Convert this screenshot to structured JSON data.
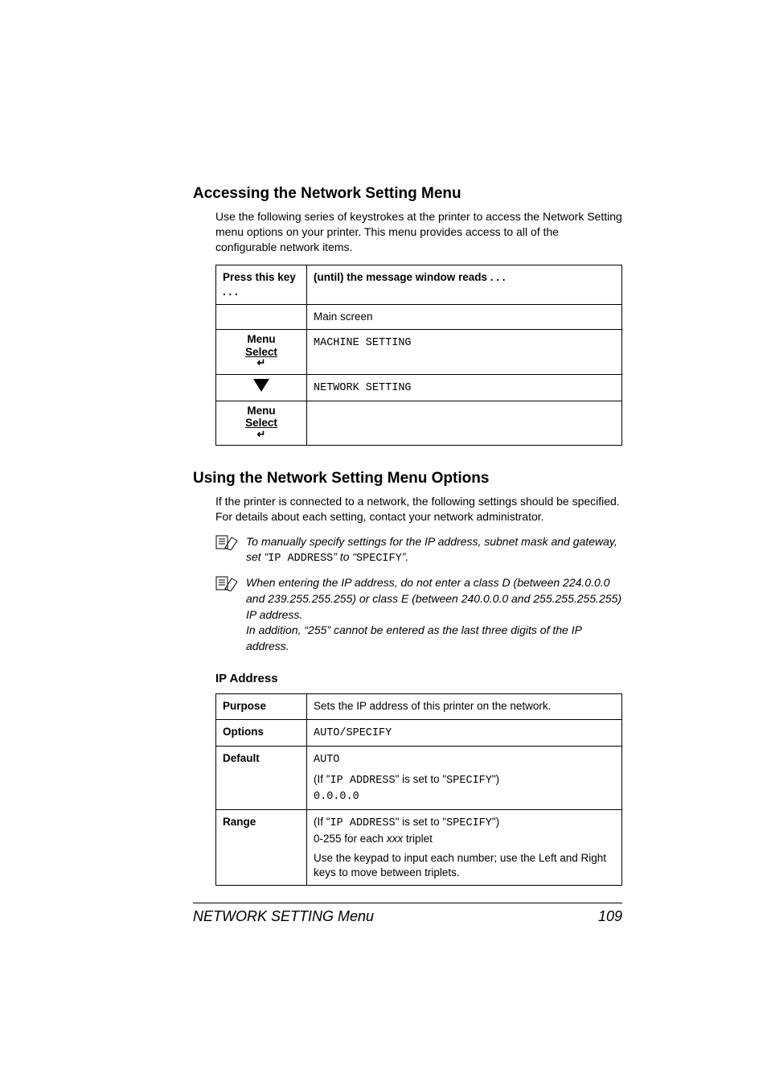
{
  "headings": {
    "h1": "Accessing the Network Setting Menu",
    "h2": "Using the Network Setting Menu Options",
    "h3": "IP Address"
  },
  "intro1": "Use the following series of keystrokes at the printer to access the Network Setting menu options on your printer. This menu provides access to all of the configurable network items.",
  "keytable": {
    "header_left": "Press this key . . .",
    "header_right": "(until) the message window reads . . .",
    "rows": [
      {
        "key_type": "blank",
        "message": "Main screen"
      },
      {
        "key_type": "menuselect",
        "message": "MACHINE SETTING"
      },
      {
        "key_type": "down",
        "message": "NETWORK SETTING"
      },
      {
        "key_type": "menuselect",
        "message": ""
      }
    ],
    "menu_label_line1": "Menu",
    "menu_label_line2": "Select"
  },
  "intro2": "If the printer is connected to a network, the following settings should be specified. For details about each setting, contact your network administrator.",
  "note1": {
    "pre": "To manually specify settings for the IP address, subnet mask and gateway, set “",
    "code1": "IP ADDRESS",
    "mid": "” to “",
    "code2": "SPECIFY",
    "post": "”."
  },
  "note2": {
    "line1": "When entering the IP address, do not enter a class D (between 224.0.0.0 and 239.255.255.255) or class E (between 240.0.0.0 and 255.255.255.255) IP address.",
    "line2": "In addition, “255” cannot be entered as the last three digits of the IP address."
  },
  "iptable": {
    "labels": {
      "purpose": "Purpose",
      "options": "Options",
      "default": "Default",
      "range": "Range"
    },
    "purpose_text": "Sets the IP address of this printer on the network.",
    "options_code": "AUTO/SPECIFY",
    "default": {
      "code1": "AUTO",
      "if_pre": "(If \"",
      "if_code1": "IP ADDRESS",
      "if_mid": "\" is set to \"",
      "if_code2": "SPECIFY",
      "if_post": "\")",
      "code2": "0.0.0.0"
    },
    "range": {
      "if_pre": "(If \"",
      "if_code1": "IP ADDRESS",
      "if_mid": "\" is set to \"",
      "if_code2": "SPECIFY",
      "if_post": "\")",
      "line2_pre": "0-255 for each ",
      "line2_ital": "xxx",
      "line2_post": " triplet",
      "line3": "Use the keypad to input each number; use the Left and Right keys to move between triplets."
    }
  },
  "footer": {
    "left": "NETWORK SETTING Menu",
    "right": "109"
  }
}
